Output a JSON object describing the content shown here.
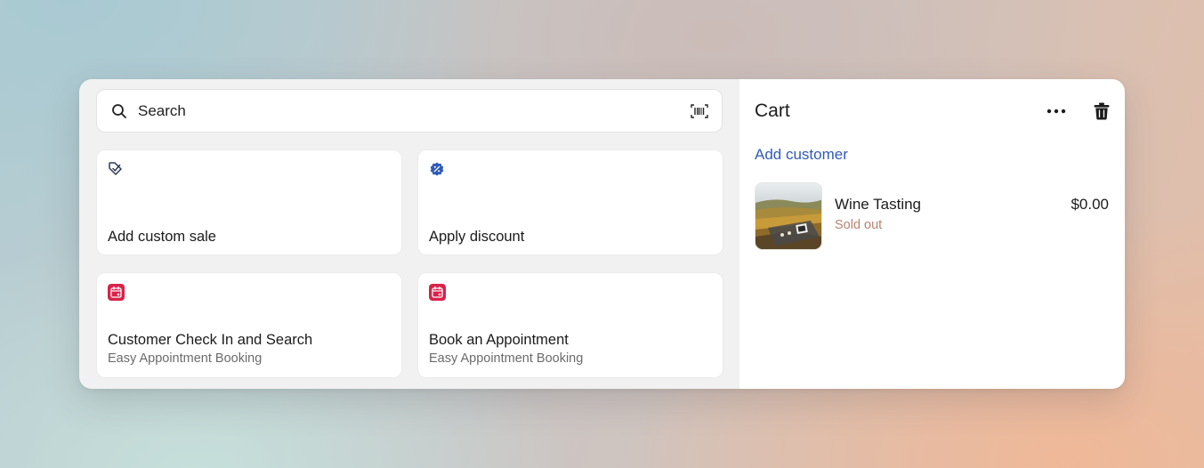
{
  "search": {
    "placeholder": "Search"
  },
  "tiles": [
    {
      "title": "Add custom sale",
      "subtitle": ""
    },
    {
      "title": "Apply discount",
      "subtitle": ""
    },
    {
      "title": "Customer Check In and Search",
      "subtitle": "Easy Appointment Booking"
    },
    {
      "title": "Book an Appointment",
      "subtitle": "Easy Appointment Booking"
    }
  ],
  "cart": {
    "title": "Cart",
    "add_customer_label": "Add customer",
    "items": [
      {
        "name": "Wine Tasting",
        "status": "Sold out",
        "price": "$0.00"
      }
    ]
  },
  "icons": {
    "search": "search-icon",
    "barcode": "barcode-scan-icon",
    "custom_sale": "tag-check-icon",
    "discount": "discount-badge-icon",
    "calendar": "calendar-icon",
    "more": "more-horizontal-icon",
    "trash": "trash-icon"
  },
  "colors": {
    "accent_link": "#2f5bb7",
    "discount_icon": "#2f5bb7",
    "calendar_icon": "#d8234a",
    "sold_out": "#b9826e"
  }
}
